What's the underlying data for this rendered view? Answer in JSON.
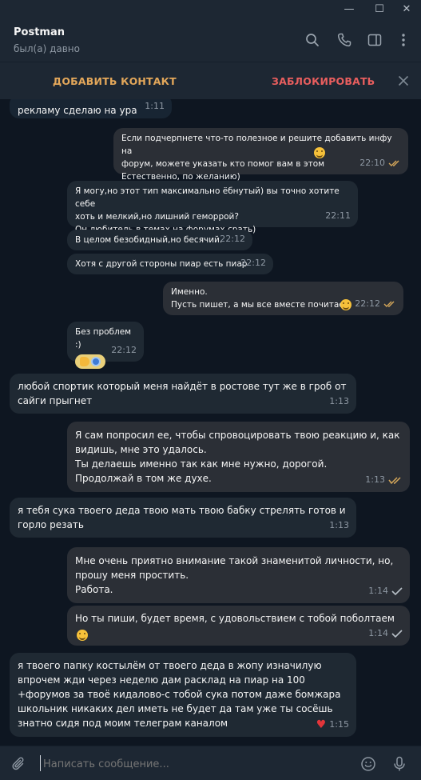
{
  "window": {
    "controls": [
      "—",
      "☐",
      "✕"
    ]
  },
  "header": {
    "contact_name": "Postman",
    "status": "был(а) давно"
  },
  "action_bar": {
    "add_contact": "ДОБАВИТЬ КОНТАКТ",
    "block": "ЗАБЛОКИРОВАТЬ"
  },
  "messages": [
    {
      "dir": "in",
      "text": "рекламу сделаю на ура",
      "time": "1:11"
    },
    {
      "dir": "out",
      "text": "Если подчерпнете что-то полезное и решите добавить инфу на\nфорум, можете указать кто помог вам в этом\nЕстественно, по желанию)",
      "time": "22:10",
      "status": "read"
    },
    {
      "dir": "in",
      "text": "Я могу,но этот тип максимально ёбнутый) вы точно хотите себе\nхоть и мелкий,но лишний геморрой?\nОн любитель в темах на форумах срать)",
      "time": "22:11"
    },
    {
      "dir": "in",
      "text": "В целом безобидный,но бесячий.",
      "time": "22:12"
    },
    {
      "dir": "in",
      "text": "Хотя с другой стороны пиар есть пиар",
      "time": "22:12"
    },
    {
      "dir": "out",
      "text": "Именно.\nПусть пишет, а мы все вместе почитаем",
      "time": "22:12",
      "status": "read"
    },
    {
      "dir": "in",
      "text": "Без проблем :)",
      "time": "22:12"
    },
    {
      "dir": "in",
      "text": "любой спортик который меня найдёт в ростове тут же в гроб от\nсайги прыгнет",
      "time": "1:13"
    },
    {
      "dir": "out",
      "text": "Я сам попросил ее, чтобы спровоцировать твою реакцию и, как\nвидишь, мне это удалось.\nТы делаешь именно так как мне нужно, дорогой.\nПродолжай в том же духе.",
      "time": "1:13",
      "status": "read"
    },
    {
      "dir": "in",
      "text": "я тебя сука твоего деда твою мать твою бабку стрелять готов и\nгорло резать",
      "time": "1:13"
    },
    {
      "dir": "out",
      "text": "Мне очень приятно внимание такой знаменитой личности, но,\nпрошу меня простить.\nРабота.",
      "time": "1:14",
      "status": "sent"
    },
    {
      "dir": "out",
      "text": "Но ты пиши, будет время, с удовольствием с тобой поболтаем",
      "time": "1:14",
      "status": "sent"
    },
    {
      "dir": "in",
      "text": "я твоего папку костылём от твоего деда в жопу изначилую\nвпрочем жди через неделю дам расклад на пиар на 100\n+форумов за твоё кидалово-с тобой сука потом даже бомжара\nшкольник никаких дел иметь не будет да там уже ты сосёшь\nзнатно сидя под моим телеграм каналом",
      "time": "1:15",
      "reaction": "♥"
    }
  ],
  "composer": {
    "placeholder": "Написать сообщение..."
  },
  "icons": {
    "search": "search-icon",
    "call": "phone-icon",
    "panel": "sidebar-icon",
    "menu": "more-vertical-icon",
    "close": "close-icon",
    "attach": "paperclip-icon",
    "emoji": "smile-icon",
    "mic": "microphone-icon"
  },
  "colors": {
    "background": "#0e1621",
    "header": "#1d2733",
    "incoming": "#182533",
    "outgoing": "#2b5278",
    "add_contact": "#e3a75a",
    "block": "#e85e5e"
  }
}
